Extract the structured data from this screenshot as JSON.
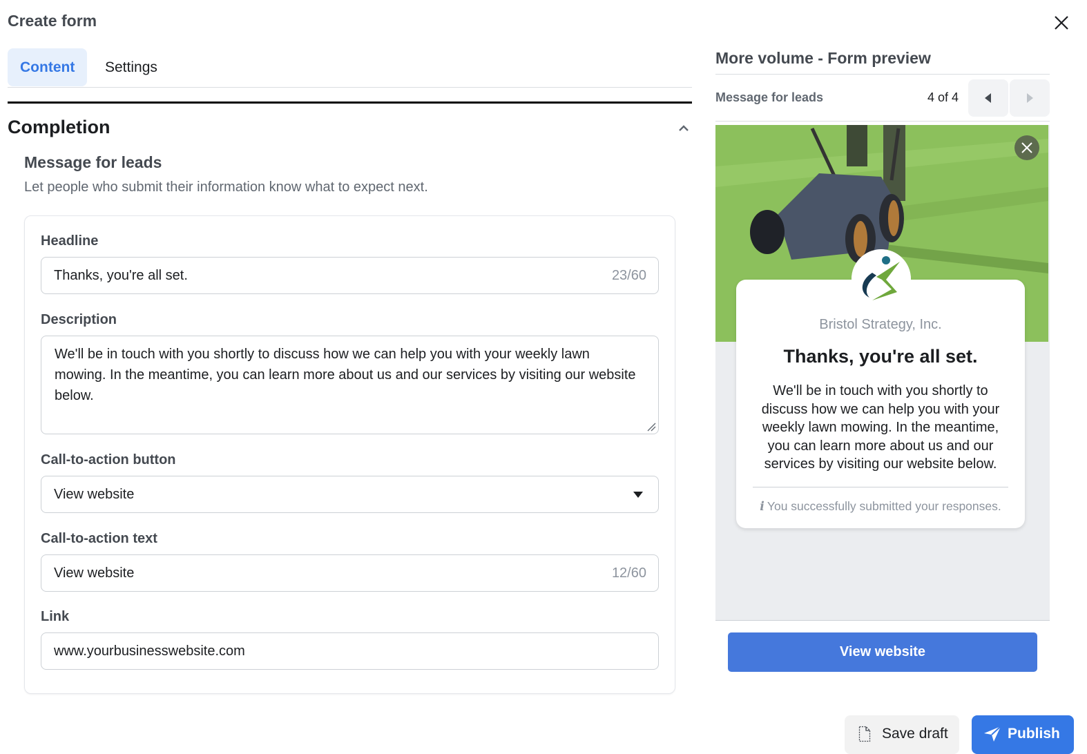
{
  "dialog": {
    "title": "Create form",
    "close_icon": "close-icon"
  },
  "tabs": [
    {
      "label": "Content",
      "active": true
    },
    {
      "label": "Settings",
      "active": false
    }
  ],
  "section": {
    "title": "Completion",
    "expanded": true,
    "subsection_title": "Message for leads",
    "subsection_description": "Let people who submit their information know what to expect next."
  },
  "fields": {
    "headline": {
      "label": "Headline",
      "value": "Thanks, you're all set.",
      "counter": "23/60"
    },
    "description": {
      "label": "Description",
      "value": "We'll be in touch with you shortly to discuss how we can help you with your weekly lawn mowing. In the meantime, you can learn more about us and our services by visiting our website below."
    },
    "cta_button": {
      "label": "Call-to-action button",
      "value": "View website"
    },
    "cta_text": {
      "label": "Call-to-action text",
      "value": "View website",
      "counter": "12/60"
    },
    "link": {
      "label": "Link",
      "value": "www.yourbusinesswebsite.com"
    }
  },
  "preview": {
    "title": "More volume - Form preview",
    "step_label": "Message for leads",
    "page_indicator": "4 of 4",
    "company_name": "Bristol Strategy, Inc.",
    "headline": "Thanks, you're all set.",
    "body": "We'll be in touch with you shortly to discuss how we can help you with your weekly lawn mowing. In the meantime, you can learn more about us and our services by visiting our website below.",
    "note_icon": "i",
    "note": "You successfully submitted your responses.",
    "cta_label": "View website"
  },
  "footer": {
    "save_label": "Save draft",
    "publish_label": "Publish"
  },
  "colors": {
    "accent": "#3578e5",
    "cta_blue": "#4578dc",
    "active_tab_bg": "#e7f0fc"
  }
}
